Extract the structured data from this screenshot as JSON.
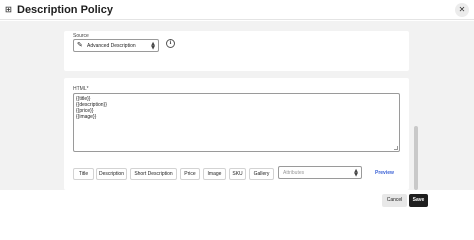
{
  "header": {
    "logo_icon": "grid-logo-icon",
    "title": "Description Policy",
    "close_icon": "close-icon",
    "close_glyph": "✕"
  },
  "source": {
    "label": "Source",
    "value": "Advanced Description",
    "value_icon": "pen-icon",
    "info_icon": "info-icon",
    "info_glyph": "i"
  },
  "html": {
    "label": "HTML*",
    "lines": [
      "{{title}}",
      "{{description}}",
      "{{price}}",
      "{{image}}"
    ]
  },
  "insert_buttons": [
    "Title",
    "Description",
    "Short Description",
    "Price",
    "Image",
    "SKU",
    "Gallery"
  ],
  "attributes": {
    "placeholder": "Attributes"
  },
  "preview_label": "Preview",
  "footer": {
    "cancel_label": "Cancel",
    "save_label": "Save"
  }
}
